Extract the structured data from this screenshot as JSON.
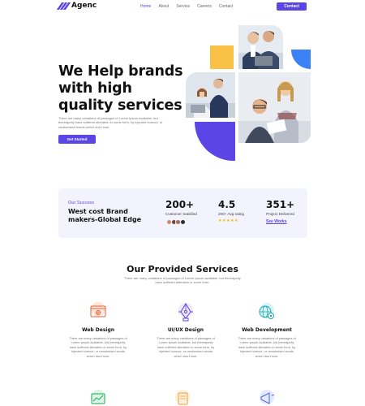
{
  "brand": {
    "name": "Agenc",
    "accent": "#5b45e6"
  },
  "nav": {
    "items": [
      {
        "label": "Home",
        "active": true
      },
      {
        "label": "About",
        "active": false
      },
      {
        "label": "Service",
        "active": false
      },
      {
        "label": "Careers",
        "active": false
      },
      {
        "label": "Contact",
        "active": false
      }
    ],
    "cta_label": "Contact"
  },
  "hero": {
    "title": "We Help brands with high quality services",
    "description": "There are many variations of passages of Lorem Ipsum available, but thereajority have suffered alteration in some form, by injected humour, or randomised words which don't look.",
    "cta_label": "Get Started"
  },
  "stats": {
    "kicker": "Our Success",
    "title": "West cost Brand makers-Global Edge",
    "items": [
      {
        "value": "200+",
        "label": "Customer Satisfied"
      },
      {
        "value": "4.5",
        "label": "200+ Avg rating"
      },
      {
        "value": "351+",
        "label": "Project Delivered"
      }
    ],
    "rating_stars": 5,
    "link_label": "See Works"
  },
  "services": {
    "title": "Our Provided Services",
    "subtitle": "There are many variations of passages of Lorem Ipsum available, but thereajority have suffered alteration in some form.",
    "cards": [
      {
        "title": "Web Design",
        "icon": "web-design-icon",
        "description": "There are many variations of passages of Lorem Ipsum available, but thereajority have suffered alteration in some form, by injected humour, or randomised words which don't look."
      },
      {
        "title": "UI/UX Design",
        "icon": "pen-tool-icon",
        "description": "There are many variations of passages of Lorem Ipsum available, but thereajority have suffered alteration in some form, by injected humour, or randomised words which don't look."
      },
      {
        "title": "Web Development",
        "icon": "web-development-icon",
        "description": "There are many variations of passages of Lorem Ipsum available, but thereajority have suffered alteration in some form, by injected humour, or randomised words which don't look."
      }
    ]
  }
}
